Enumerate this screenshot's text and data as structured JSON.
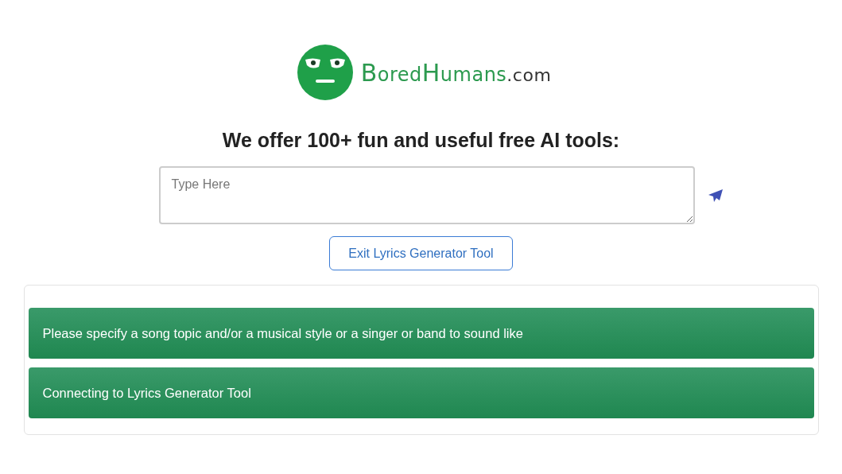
{
  "logo": {
    "parts": [
      {
        "text": "B",
        "kind": "cap"
      },
      {
        "text": "ored",
        "kind": "lower"
      },
      {
        "text": "H",
        "kind": "cap"
      },
      {
        "text": "umans",
        "kind": "lower"
      },
      {
        "text": ".com",
        "kind": "domain"
      }
    ]
  },
  "heading": "We offer 100+ fun and useful free AI tools:",
  "input": {
    "placeholder": "Type Here"
  },
  "exit_button": "Exit Lyrics Generator Tool",
  "messages": [
    {
      "text": "Please specify a song topic and/or a musical style or a singer or band to sound like"
    },
    {
      "text": "Connecting to Lyrics Generator Tool"
    }
  ]
}
